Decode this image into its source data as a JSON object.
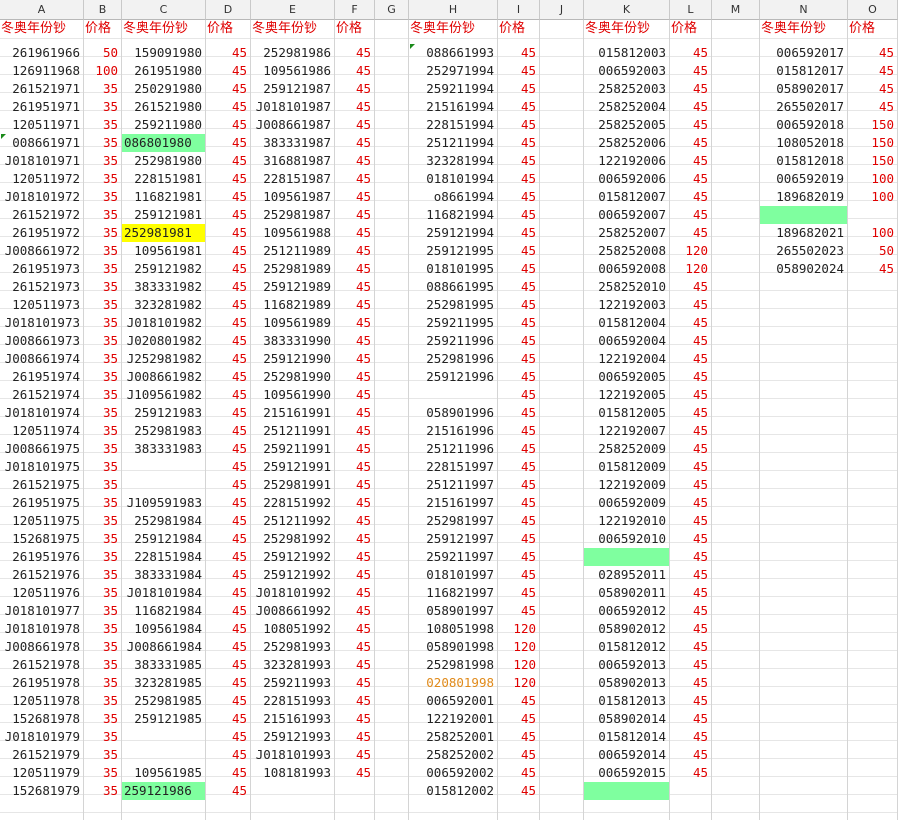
{
  "columns": [
    {
      "letter": "A",
      "kind": "code",
      "header": "冬奥年份钞",
      "cells": [
        "261961966",
        "126911968",
        "261521971",
        "261951971",
        "120511971",
        "008661971",
        "J018101971",
        "120511972",
        "J018101972",
        "261521972",
        "261951972",
        "J008661972",
        "261951973",
        "261521973",
        "120511973",
        "J018101973",
        "J008661973",
        "J008661974",
        "261951974",
        "261521974",
        "J018101974",
        "120511974",
        "J008661975",
        "J018101975",
        "261521975",
        "261951975",
        "120511975",
        "152681975",
        "261951976",
        "261521976",
        "120511976",
        "J018101977",
        "J018101978",
        "J008661978",
        "261521978",
        "261951978",
        "120511978",
        "152681978",
        "J018101979",
        "261521979",
        "120511979",
        "152681979"
      ]
    },
    {
      "letter": "B",
      "kind": "price",
      "header": "价格",
      "cells": [
        "50",
        "100",
        "35",
        "35",
        "35",
        "35",
        "35",
        "35",
        "35",
        "35",
        "35",
        "35",
        "35",
        "35",
        "35",
        "35",
        "35",
        "35",
        "35",
        "35",
        "35",
        "35",
        "35",
        "35",
        "35",
        "35",
        "35",
        "35",
        "35",
        "35",
        "35",
        "35",
        "35",
        "35",
        "35",
        "35",
        "35",
        "35",
        "35",
        "35",
        "35",
        "35"
      ]
    },
    {
      "letter": "C",
      "kind": "code",
      "header": "冬奥年份钞",
      "cells": [
        "159091980",
        "261951980",
        "250291980",
        "261521980",
        "259211980",
        "086801980",
        "252981980",
        "228151981",
        "116821981",
        "259121981",
        "252981981",
        "109561981",
        "259121982",
        "383331982",
        "323281982",
        "J018101982",
        "J020801982",
        "J252981982",
        "J008661982",
        "J109561982",
        "259121983",
        "252981983",
        "383331983",
        "",
        "",
        "J109591983",
        "252981984",
        "259121984",
        "228151984",
        "383331984",
        "J018101984",
        "116821984",
        "109561984",
        "J008661984",
        "383331985",
        "323281985",
        "252981985",
        "259121985",
        "",
        "",
        "109561985",
        "259121986"
      ]
    },
    {
      "letter": "D",
      "kind": "price",
      "header": "价格",
      "cells": [
        "45",
        "45",
        "45",
        "45",
        "45",
        "45",
        "45",
        "45",
        "45",
        "45",
        "45",
        "45",
        "45",
        "45",
        "45",
        "45",
        "45",
        "45",
        "45",
        "45",
        "45",
        "45",
        "45",
        "45",
        "45",
        "45",
        "45",
        "45",
        "45",
        "45",
        "45",
        "45",
        "45",
        "45",
        "45",
        "45",
        "45",
        "45",
        "45",
        "45",
        "45",
        "45"
      ]
    },
    {
      "letter": "E",
      "kind": "code",
      "header": "冬奥年份钞",
      "cells": [
        "252981986",
        "109561986",
        "259121987",
        "J018101987",
        "J008661987",
        "383331987",
        "316881987",
        "228151987",
        "109561987",
        "252981987",
        "109561988",
        "251211989",
        "252981989",
        "259121989",
        "116821989",
        "109561989",
        "383331990",
        "259121990",
        "252981990",
        "109561990",
        "215161991",
        "251211991",
        "259211991",
        "259121991",
        "252981991",
        "228151992",
        "251211992",
        "252981992",
        "259121992",
        "259121992",
        "J018101992",
        "J008661992",
        "108051992",
        "252981993",
        "323281993",
        "259211993",
        "228151993",
        "215161993",
        "259121993",
        "J018101993",
        "108181993"
      ]
    },
    {
      "letter": "F",
      "kind": "price",
      "header": "价格",
      "cells": [
        "45",
        "45",
        "45",
        "45",
        "45",
        "45",
        "45",
        "45",
        "45",
        "45",
        "45",
        "45",
        "45",
        "45",
        "45",
        "45",
        "45",
        "45",
        "45",
        "45",
        "45",
        "45",
        "45",
        "45",
        "45",
        "45",
        "45",
        "45",
        "45",
        "45",
        "45",
        "45",
        "45",
        "45",
        "45",
        "45",
        "45",
        "45",
        "45",
        "45",
        "45"
      ]
    },
    {
      "letter": "G",
      "kind": "blank",
      "header": "",
      "cells": []
    },
    {
      "letter": "H",
      "kind": "code",
      "header": "冬奥年份钞",
      "cells": [
        "088661993",
        "252971994",
        "259211994",
        "215161994",
        "228151994",
        "251211994",
        "323281994",
        "018101994",
        "o8661994",
        "116821994",
        "259121994",
        "259121995",
        "018101995",
        "088661995",
        "252981995",
        "259211995",
        "259211996",
        "252981996",
        "259121996",
        "",
        "058901996",
        "215161996",
        "251211996",
        "228151997",
        "251211997",
        "215161997",
        "252981997",
        "259121997",
        "259211997",
        "018101997",
        "116821997",
        "058901997",
        "108051998",
        "058901998",
        "252981998",
        "020801998",
        "006592001",
        "122192001",
        "258252001",
        "258252002",
        "006592002",
        "015812002"
      ]
    },
    {
      "letter": "I",
      "kind": "price",
      "header": "价格",
      "cells": [
        "45",
        "45",
        "45",
        "45",
        "45",
        "45",
        "45",
        "45",
        "45",
        "45",
        "45",
        "45",
        "45",
        "45",
        "45",
        "45",
        "45",
        "45",
        "45",
        "45",
        "45",
        "45",
        "45",
        "45",
        "45",
        "45",
        "45",
        "45",
        "45",
        "45",
        "45",
        "45",
        "120",
        "120",
        "120",
        "120",
        "45",
        "45",
        "45",
        "45",
        "45",
        "45"
      ]
    },
    {
      "letter": "J",
      "kind": "blank",
      "header": "",
      "cells": []
    },
    {
      "letter": "K",
      "kind": "code",
      "header": "冬奥年份钞",
      "cells": [
        "015812003",
        "006592003",
        "258252003",
        "258252004",
        "258252005",
        "258252006",
        "122192006",
        "006592006",
        "015812007",
        "006592007",
        "258252007",
        "258252008",
        "006592008",
        "258252010",
        "122192003",
        "015812004",
        "006592004",
        "122192004",
        "006592005",
        "122192005",
        "015812005",
        "122192007",
        "258252009",
        "015812009",
        "122192009",
        "006592009",
        "122192010",
        "006592010",
        "",
        "028952011",
        "058902011",
        "006592012",
        "058902012",
        "015812012",
        "006592013",
        "058902013",
        "015812013",
        "058902014",
        "015812014",
        "006592014",
        "006592015",
        ""
      ]
    },
    {
      "letter": "L",
      "kind": "price",
      "header": "价格",
      "cells": [
        "45",
        "45",
        "45",
        "45",
        "45",
        "45",
        "45",
        "45",
        "45",
        "45",
        "45",
        "120",
        "120",
        "45",
        "45",
        "45",
        "45",
        "45",
        "45",
        "45",
        "45",
        "45",
        "45",
        "45",
        "45",
        "45",
        "45",
        "45",
        "45",
        "45",
        "45",
        "45",
        "45",
        "45",
        "45",
        "45",
        "45",
        "45",
        "45",
        "45",
        "45",
        ""
      ]
    },
    {
      "letter": "M",
      "kind": "blank",
      "header": "",
      "cells": []
    },
    {
      "letter": "N",
      "kind": "code",
      "header": "冬奥年份钞",
      "cells": [
        "006592017",
        "015812017",
        "058902017",
        "265502017",
        "006592018",
        "108052018",
        "015812018",
        "006592019",
        "189682019",
        "",
        "189682021",
        "265502023",
        "058902024"
      ]
    },
    {
      "letter": "O",
      "kind": "price",
      "header": "价格",
      "cells": [
        "45",
        "45",
        "45",
        "45",
        "150",
        "150",
        "150",
        "100",
        "100",
        "",
        "100",
        "50",
        "45"
      ]
    }
  ],
  "highlights": {
    "green": "#7fff9f",
    "yellow": "#ffff00",
    "price_red": "#e00000",
    "orange_text": "#e08a1a"
  }
}
